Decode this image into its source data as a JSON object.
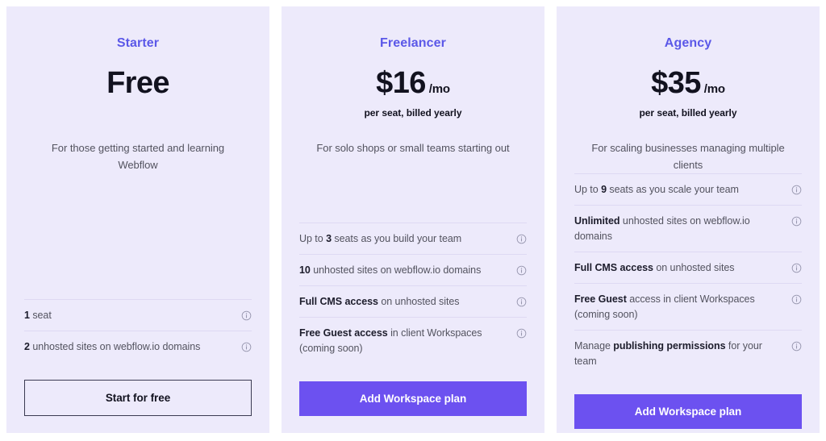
{
  "plans": [
    {
      "name": "Starter",
      "price": "Free",
      "period": "",
      "price_note": "",
      "description": "For those getting started and learning Webflow",
      "features": [
        {
          "lead": "1",
          "rest": " seat",
          "info_icon": "info-circle-icon"
        },
        {
          "lead": "2",
          "rest": " unhosted sites on webflow.io domains",
          "info_icon": "info-circle-icon"
        }
      ],
      "cta_label": "Start for free",
      "cta_style": "outline"
    },
    {
      "name": "Freelancer",
      "price": "$16",
      "period": "/mo",
      "price_note": "per seat, billed yearly",
      "description": "For solo shops or small teams starting out",
      "features": [
        {
          "prefix": "Up to ",
          "lead": "3",
          "rest": " seats as you build your team",
          "info_icon": "info-circle-icon"
        },
        {
          "lead": "10",
          "rest": " unhosted sites on webflow.io domains",
          "info_icon": "info-circle-icon"
        },
        {
          "lead": "Full CMS access",
          "rest": " on unhosted sites",
          "info_icon": "info-circle-icon"
        },
        {
          "lead": "Free Guest access",
          "rest": " in client Workspaces (coming soon)",
          "info_icon": "info-circle-icon"
        }
      ],
      "cta_label": "Add Workspace plan",
      "cta_style": "solid"
    },
    {
      "name": "Agency",
      "price": "$35",
      "period": "/mo",
      "price_note": "per seat, billed yearly",
      "description": "For scaling businesses managing multiple clients",
      "features": [
        {
          "prefix": "Up to ",
          "lead": "9",
          "rest": " seats as you scale your team",
          "info_icon": "info-circle-icon"
        },
        {
          "lead": "Unlimited",
          "rest": " unhosted sites on webflow.io domains",
          "info_icon": "info-circle-icon"
        },
        {
          "lead": "Full CMS access",
          "rest": " on unhosted sites",
          "info_icon": "info-circle-icon"
        },
        {
          "lead": "Free Guest",
          "rest": " access in client Workspaces (coming soon)",
          "info_icon": "info-circle-icon"
        },
        {
          "prefix": "Manage ",
          "lead": "publishing permissions",
          "rest": " for your team",
          "info_icon": "info-circle-icon"
        }
      ],
      "cta_label": "Add Workspace plan",
      "cta_style": "solid"
    }
  ],
  "colors": {
    "card_background": "#edeafb",
    "page_background": "#ffffff",
    "plan_name": "#5b58e8",
    "cta_solid": "#6c51f0",
    "cta_outline_border": "#3b3b52",
    "divider": "#ded9f3",
    "body_text": "#53535f",
    "strong_text": "#1c1c2b"
  }
}
